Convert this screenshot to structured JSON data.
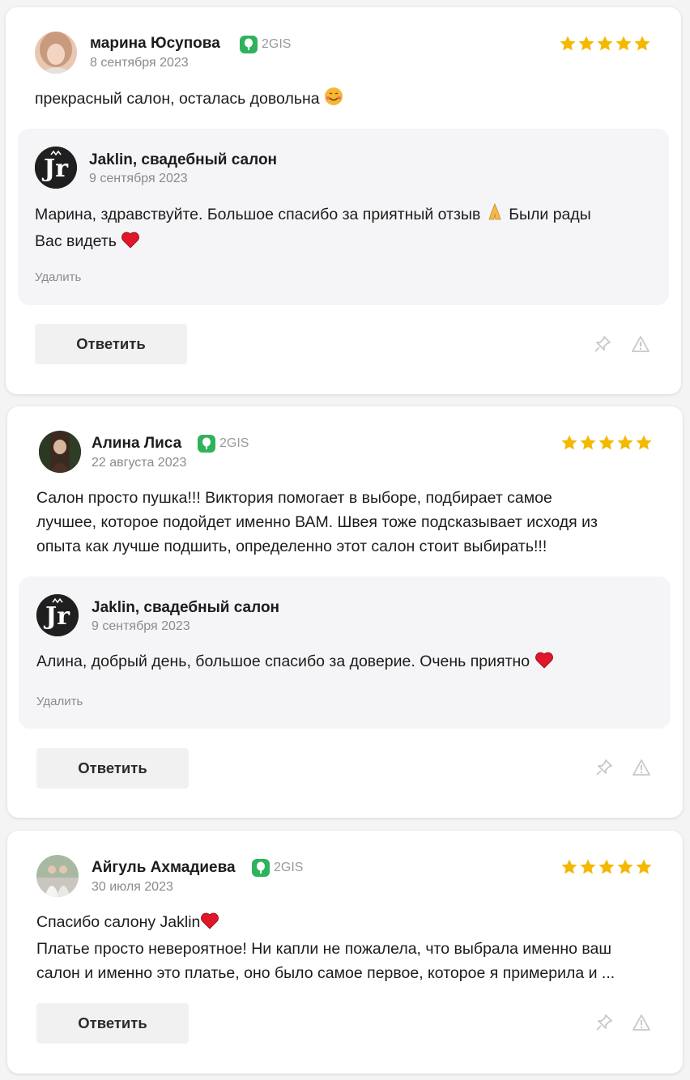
{
  "source_label": "2GIS",
  "reply_button_label": "Ответить",
  "delete_label": "Удалить",
  "star_color": "#f5b800",
  "reviews": [
    {
      "author": "марина Юсупова",
      "date": "8 сентября 2023",
      "rating": 5,
      "text": "прекрасный салон, осталась довольна",
      "reply": {
        "author": "Jaklin, свадебный салон",
        "date": "9 сентября 2023",
        "text_line1": "Марина, здравствуйте. Большое спасибо за приятный отзыв",
        "text_line1b": "Были рады",
        "text_line2": "Вас видеть"
      }
    },
    {
      "author": "Алина Лиса",
      "date": "22 августа 2023",
      "rating": 5,
      "text_lines": [
        "Салон просто пушка!!! Виктория помогает в выборе, подбирает самое",
        "лучшее, которое подойдет именно ВАМ. Швея тоже подсказывает исходя из",
        "опыта как лучше подшить, определенно этот салон стоит выбирать!!!"
      ],
      "reply": {
        "author": "Jaklin, свадебный салон",
        "date": "9 сентября 2023",
        "text": "Алина, добрый день, большое спасибо за доверие. Очень приятно"
      }
    },
    {
      "author": "Айгуль Ахмадиева",
      "date": "30 июля 2023",
      "rating": 5,
      "text_line1": "Спасибо салону Jaklin",
      "text_lines": [
        "Платье просто невероятное! Ни капли не пожалела, что выбрала именно ваш",
        "салон и именно это платье, оно было самое первое, которое я примерила и ..."
      ]
    }
  ]
}
